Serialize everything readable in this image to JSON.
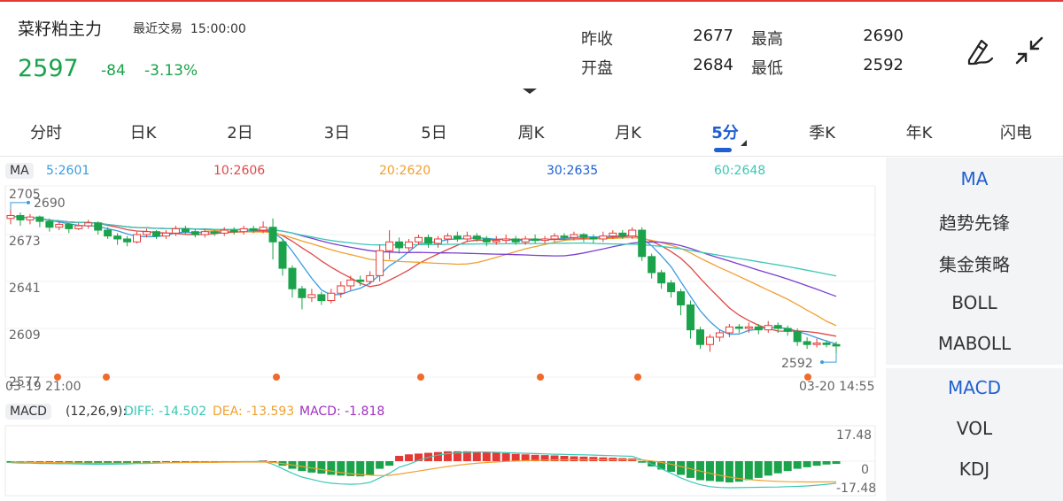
{
  "header": {
    "symbol": "菜籽粕主力",
    "trade_label": "最近交易",
    "trade_time": "15:00:00",
    "price": "2597",
    "change": "-84",
    "change_pct": "-3.13%"
  },
  "quote": {
    "prev_close_label": "昨收",
    "prev_close": "2677",
    "high_label": "最高",
    "high": "2690",
    "open_label": "开盘",
    "open": "2684",
    "low_label": "最低",
    "low": "2592"
  },
  "tabs": [
    "分时",
    "日K",
    "2日",
    "3日",
    "5日",
    "周K",
    "月K",
    "5分",
    "季K",
    "年K",
    "闪电"
  ],
  "active_tab": "5分",
  "side_top": [
    "MA",
    "趋势先锋",
    "集金策略",
    "BOLL",
    "MABOLL"
  ],
  "side_bottom": [
    "MACD",
    "VOL",
    "KDJ"
  ],
  "ma_legend": {
    "label": "MA",
    "ma5": "5:2601",
    "ma10": "10:2606",
    "ma20": "20:2620",
    "ma30": "30:2635",
    "ma60": "60:2648"
  },
  "macd_legend": {
    "label": "MACD",
    "params": "(12,26,9):",
    "diff": "DIFF: -14.502",
    "dea": "DEA: -13.593",
    "macd": "MACD: -1.818"
  },
  "colors": {
    "up": "#e53935",
    "down": "#1aa34a",
    "ma5": "#3b9be0",
    "ma10": "#e04848",
    "ma20": "#f0a030",
    "ma30": "#7a3fd0",
    "ma60": "#3cc8b4",
    "accent": "#1f5fd1"
  },
  "chart_data": {
    "type": "candlestick",
    "x_start": "03-19 21:00",
    "x_end": "03-20 14:55",
    "y_ticks": [
      "2705",
      "2673",
      "2641",
      "2609",
      "2577"
    ],
    "ylim": [
      2577,
      2705
    ],
    "high_marker": "2690",
    "low_marker": "2592",
    "candles": [
      [
        2684,
        2686,
        2690,
        2680
      ],
      [
        2686,
        2683,
        2688,
        2679
      ],
      [
        2683,
        2685,
        2687,
        2680
      ],
      [
        2685,
        2682,
        2686,
        2678
      ],
      [
        2682,
        2678,
        2684,
        2675
      ],
      [
        2678,
        2680,
        2682,
        2676
      ],
      [
        2680,
        2677,
        2681,
        2674
      ],
      [
        2677,
        2679,
        2681,
        2676
      ],
      [
        2679,
        2681,
        2683,
        2677
      ],
      [
        2681,
        2676,
        2682,
        2673
      ],
      [
        2676,
        2672,
        2678,
        2670
      ],
      [
        2672,
        2670,
        2674,
        2666
      ],
      [
        2670,
        2668,
        2672,
        2665
      ],
      [
        2668,
        2673,
        2675,
        2667
      ],
      [
        2673,
        2675,
        2677,
        2671
      ],
      [
        2675,
        2672,
        2676,
        2670
      ],
      [
        2672,
        2674,
        2676,
        2670
      ],
      [
        2674,
        2677,
        2679,
        2672
      ],
      [
        2677,
        2675,
        2679,
        2673
      ],
      [
        2675,
        2673,
        2677,
        2671
      ],
      [
        2673,
        2675,
        2677,
        2671
      ],
      [
        2675,
        2674,
        2676,
        2672
      ],
      [
        2674,
        2676,
        2678,
        2672
      ],
      [
        2676,
        2675,
        2678,
        2673
      ],
      [
        2675,
        2677,
        2679,
        2673
      ],
      [
        2677,
        2676,
        2679,
        2674
      ],
      [
        2676,
        2678,
        2682,
        2674
      ],
      [
        2678,
        2668,
        2684,
        2656
      ],
      [
        2668,
        2650,
        2670,
        2645
      ],
      [
        2650,
        2636,
        2652,
        2630
      ],
      [
        2636,
        2630,
        2638,
        2622
      ],
      [
        2630,
        2632,
        2636,
        2627
      ],
      [
        2632,
        2628,
        2634,
        2625
      ],
      [
        2628,
        2633,
        2636,
        2626
      ],
      [
        2633,
        2638,
        2641,
        2630
      ],
      [
        2638,
        2642,
        2645,
        2635
      ],
      [
        2642,
        2641,
        2645,
        2638
      ],
      [
        2641,
        2645,
        2648,
        2639
      ],
      [
        2645,
        2662,
        2666,
        2641
      ],
      [
        2662,
        2668,
        2676,
        2656
      ],
      [
        2668,
        2664,
        2671,
        2660
      ],
      [
        2664,
        2668,
        2670,
        2662
      ],
      [
        2668,
        2671,
        2673,
        2666
      ],
      [
        2671,
        2667,
        2673,
        2664
      ],
      [
        2667,
        2670,
        2672,
        2664
      ],
      [
        2670,
        2672,
        2674,
        2667
      ],
      [
        2672,
        2670,
        2675,
        2668
      ],
      [
        2670,
        2672,
        2675,
        2668
      ],
      [
        2672,
        2670,
        2674,
        2668
      ],
      [
        2670,
        2668,
        2672,
        2665
      ],
      [
        2668,
        2669,
        2672,
        2666
      ],
      [
        2669,
        2670,
        2673,
        2667
      ],
      [
        2670,
        2668,
        2672,
        2666
      ],
      [
        2668,
        2670,
        2672,
        2666
      ],
      [
        2670,
        2669,
        2673,
        2667
      ],
      [
        2669,
        2670,
        2672,
        2667
      ],
      [
        2670,
        2672,
        2674,
        2668
      ],
      [
        2672,
        2671,
        2674,
        2669
      ],
      [
        2671,
        2673,
        2675,
        2669
      ],
      [
        2673,
        2671,
        2674,
        2668
      ],
      [
        2671,
        2670,
        2673,
        2667
      ],
      [
        2670,
        2672,
        2675,
        2668
      ],
      [
        2672,
        2674,
        2676,
        2670
      ],
      [
        2674,
        2672,
        2676,
        2670
      ],
      [
        2672,
        2676,
        2678,
        2670
      ],
      [
        2676,
        2658,
        2678,
        2655
      ],
      [
        2658,
        2647,
        2660,
        2643
      ],
      [
        2647,
        2640,
        2649,
        2636
      ],
      [
        2640,
        2634,
        2642,
        2630
      ],
      [
        2634,
        2625,
        2636,
        2618
      ],
      [
        2625,
        2608,
        2628,
        2602
      ],
      [
        2608,
        2598,
        2610,
        2595
      ],
      [
        2598,
        2603,
        2605,
        2593
      ],
      [
        2603,
        2606,
        2608,
        2600
      ],
      [
        2606,
        2610,
        2612,
        2603
      ],
      [
        2610,
        2609,
        2612,
        2606
      ],
      [
        2609,
        2610,
        2613,
        2606
      ],
      [
        2610,
        2608,
        2612,
        2605
      ],
      [
        2608,
        2611,
        2614,
        2606
      ],
      [
        2611,
        2609,
        2613,
        2606
      ],
      [
        2609,
        2607,
        2611,
        2604
      ],
      [
        2607,
        2600,
        2609,
        2597
      ],
      [
        2600,
        2598,
        2603,
        2595
      ],
      [
        2598,
        2599,
        2602,
        2596
      ],
      [
        2599,
        2598,
        2601,
        2596
      ],
      [
        2598,
        2597,
        2600,
        2592
      ]
    ],
    "macd": {
      "ylim": [
        -17.48,
        17.48
      ],
      "y_ticks": [
        "17.48",
        "0",
        "-17.48"
      ],
      "hist": [
        -1,
        -1.2,
        -1,
        -1.5,
        -1.6,
        -1.4,
        -1.2,
        -1.5,
        -1.8,
        -2,
        -1.8,
        -1.6,
        -1.4,
        -1.2,
        -1,
        -0.8,
        -0.6,
        -0.4,
        -0.5,
        -0.4,
        -0.3,
        -0.3,
        -0.2,
        -0.3,
        -0.2,
        -0.3,
        0.5,
        -1,
        -3,
        -5,
        -6.5,
        -7.5,
        -8.2,
        -9,
        -9.5,
        -9.8,
        -10,
        -9,
        -5,
        -3,
        3.5,
        4.5,
        5,
        5.5,
        6,
        6.5,
        6.5,
        6.5,
        6.2,
        6,
        5.6,
        5.2,
        4.8,
        4.5,
        4.2,
        4,
        3.8,
        3.5,
        3.2,
        3,
        2.8,
        2.5,
        2.3,
        2,
        1.8,
        -1,
        -3.5,
        -5.5,
        -7,
        -9,
        -11,
        -12.5,
        -13,
        -13.5,
        -14,
        -13.5,
        -12.5,
        -11,
        -9.5,
        -8,
        -6.5,
        -5,
        -4,
        -3,
        -2.2,
        -1.8
      ],
      "diff": [
        -1,
        -1.2,
        -1.3,
        -1.5,
        -1.6,
        -1.7,
        -1.7,
        -1.8,
        -2,
        -2.1,
        -2,
        -1.9,
        -1.8,
        -1.6,
        -1.5,
        -1.3,
        -1.1,
        -0.9,
        -0.8,
        -0.7,
        -0.6,
        -0.5,
        -0.4,
        -0.4,
        -0.3,
        -0.3,
        0,
        -2,
        -5,
        -8,
        -10.5,
        -12,
        -13.5,
        -14.5,
        -15,
        -15.2,
        -15,
        -14,
        -11,
        -8,
        -4,
        -2,
        0.5,
        2.5,
        4,
        5,
        5.5,
        5.8,
        6,
        6,
        5.8,
        5.6,
        5.4,
        5.2,
        5,
        4.8,
        4.6,
        4.5,
        4.3,
        4.2,
        4,
        3.8,
        3.6,
        3.4,
        3.2,
        1,
        -2,
        -5,
        -8,
        -11,
        -13.5,
        -15.5,
        -16.8,
        -17.3,
        -17.5,
        -17.4,
        -17.3,
        -17.2,
        -17.1,
        -17,
        -16.8,
        -16.6,
        -16.3,
        -15.8,
        -15.2,
        -14.5
      ],
      "dea": [
        -0.5,
        -0.6,
        -0.7,
        -0.8,
        -0.9,
        -1,
        -1.1,
        -1.2,
        -1.3,
        -1.4,
        -1.4,
        -1.4,
        -1.4,
        -1.3,
        -1.3,
        -1.2,
        -1.1,
        -1,
        -0.9,
        -0.9,
        -0.8,
        -0.8,
        -0.7,
        -0.7,
        -0.6,
        -0.6,
        -0.5,
        -0.8,
        -1.5,
        -2.5,
        -3.5,
        -4.5,
        -5.5,
        -6.5,
        -7.5,
        -8.2,
        -8.8,
        -9.2,
        -9.5,
        -9.3,
        -8.5,
        -7.5,
        -6.5,
        -5.5,
        -4.5,
        -3.5,
        -2.7,
        -2,
        -1.4,
        -0.9,
        -0.5,
        -0.2,
        0.1,
        0.3,
        0.5,
        0.7,
        0.8,
        0.9,
        1,
        1,
        1,
        1,
        1,
        1,
        1,
        0.8,
        0.2,
        -0.8,
        -2,
        -3.5,
        -5,
        -6.5,
        -8,
        -9.3,
        -10.5,
        -11.4,
        -12.1,
        -12.6,
        -13,
        -13.3,
        -13.5,
        -13.6,
        -13.7,
        -13.7,
        -13.65,
        -13.593
      ],
      "hist_scale_note": ""
    }
  }
}
